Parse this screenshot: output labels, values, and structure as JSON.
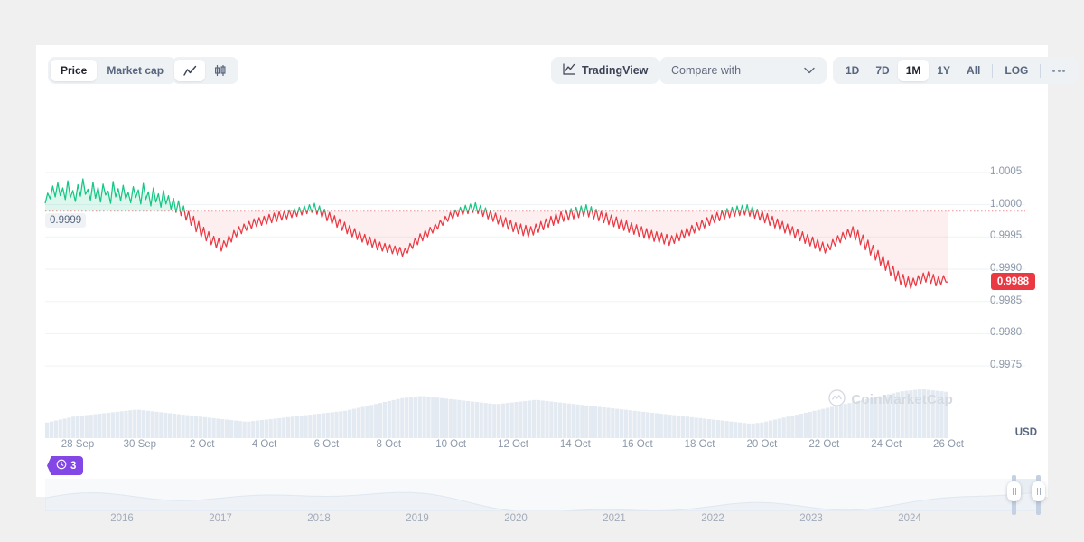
{
  "toolbar": {
    "metric_tabs": [
      {
        "label": "Price",
        "active": true
      },
      {
        "label": "Market cap",
        "active": false
      }
    ],
    "chart_type_icons": [
      {
        "name": "line-chart-icon",
        "active": true
      },
      {
        "name": "candlestick-chart-icon",
        "active": false
      }
    ],
    "tradingview_label": "TradingView",
    "tradingview_icon": "line-chart-icon",
    "compare_placeholder": "Compare with",
    "compare_chevron": "chevron-down-icon",
    "ranges": [
      {
        "label": "1D",
        "active": false
      },
      {
        "label": "7D",
        "active": false
      },
      {
        "label": "1M",
        "active": true
      },
      {
        "label": "1Y",
        "active": false
      },
      {
        "label": "All",
        "active": false
      }
    ],
    "log_label": "LOG",
    "more_icon": "ellipsis-icon"
  },
  "chart_overlay": {
    "currency_label": "USD",
    "current_price_badge": "0.9988",
    "baseline_label": "0.9999",
    "watermark": "CoinMarketCap",
    "watermark_icon": "coinmarketcap-logo-icon",
    "events_badge_count": "3",
    "events_badge_icon": "clock-icon"
  },
  "colors": {
    "up": "#16c784",
    "down": "#ea3943",
    "badge": "#ea3943",
    "events": "#8247e5",
    "volume": "#e4eaf1",
    "axis_text": "#8c98a9"
  },
  "chart_data": {
    "type": "line",
    "title": "",
    "xlabel": "",
    "ylabel": "USD",
    "ylim": [
      0.99725,
      1.00075
    ],
    "yticks": [
      "1.0005",
      "1.0000",
      "0.9995",
      "0.9990",
      "0.9985",
      "0.9980",
      "0.9975"
    ],
    "ytick_values": [
      1.0005,
      1.0,
      0.9995,
      0.999,
      0.9985,
      0.998,
      0.9975
    ],
    "xticks": [
      "28 Sep",
      "30 Sep",
      "2 Oct",
      "4 Oct",
      "6 Oct",
      "8 Oct",
      "10 Oct",
      "12 Oct",
      "14 Oct",
      "16 Oct",
      "18 Oct",
      "20 Oct",
      "22 Oct",
      "24 Oct",
      "26 Oct"
    ],
    "baseline": 0.9999,
    "last_value": 0.9988,
    "grid": true,
    "legend": "none",
    "series": [
      {
        "name": "Price (USD)",
        "color_up": "#16c784",
        "color_down": "#ea3943",
        "values": [
          1.00002,
          1.00018,
          1.00009,
          1.00029,
          1.00012,
          1.00034,
          1.00014,
          1.00026,
          1.00008,
          1.00037,
          1.00011,
          1.00022,
          1.00005,
          1.00031,
          1.00013,
          1.0004,
          1.00016,
          1.00024,
          1.00007,
          1.00035,
          1.0001,
          1.00027,
          1.00004,
          1.00032,
          1.00015,
          1.00021,
          1.00002,
          1.00036,
          1.00012,
          1.00025,
          1.00006,
          1.0003,
          1.00009,
          1.00019,
          1.00003,
          1.00028,
          1.00011,
          1.00023,
          1.00001,
          1.00033,
          1.00008,
          1.0002,
          0.99998,
          1.00026,
          1.00004,
          1.00017,
          0.99996,
          1.00022,
          1.00001,
          1.00014,
          0.99993,
          1.0001,
          0.99988,
          1.00006,
          0.99983,
          0.99998,
          0.99976,
          0.9999,
          0.99968,
          0.99982,
          0.99958,
          0.99974,
          0.9995,
          0.99965,
          0.99944,
          0.99958,
          0.99938,
          0.99951,
          0.99933,
          0.99948,
          0.99928,
          0.99944,
          0.99935,
          0.99952,
          0.99942,
          0.9996,
          0.9995,
          0.99966,
          0.99955,
          0.9997,
          0.9996,
          0.99974,
          0.99963,
          0.99978,
          0.99966,
          0.9998,
          0.99968,
          0.99982,
          0.9997,
          0.99985,
          0.99972,
          0.99987,
          0.99974,
          0.99989,
          0.99976,
          0.9999,
          0.99978,
          0.99992,
          0.9998,
          0.99994,
          0.99982,
          0.99996,
          0.99984,
          0.99998,
          0.99986,
          1.0,
          0.99988,
          1.00002,
          0.99985,
          0.99998,
          0.9998,
          0.99993,
          0.99975,
          0.99988,
          0.9997,
          0.99983,
          0.99965,
          0.99978,
          0.9996,
          0.99973,
          0.99955,
          0.99968,
          0.9995,
          0.99963,
          0.99946,
          0.99958,
          0.99942,
          0.99954,
          0.99938,
          0.9995,
          0.99934,
          0.99946,
          0.9993,
          0.99942,
          0.99928,
          0.9994,
          0.99926,
          0.99938,
          0.99924,
          0.99936,
          0.99922,
          0.99934,
          0.9992,
          0.99932,
          0.99925,
          0.9994,
          0.99932,
          0.99948,
          0.99938,
          0.99955,
          0.99944,
          0.9996,
          0.9995,
          0.99965,
          0.99956,
          0.9997,
          0.99962,
          0.99976,
          0.99968,
          0.99982,
          0.99974,
          0.99988,
          0.99978,
          0.99992,
          0.99982,
          0.99996,
          0.99984,
          0.99999,
          0.99986,
          1.00001,
          0.99988,
          1.00003,
          0.99986,
          0.99999,
          0.99982,
          0.99995,
          0.99978,
          0.99991,
          0.99974,
          0.99987,
          0.9997,
          0.99983,
          0.99966,
          0.9998,
          0.99962,
          0.99976,
          0.99958,
          0.99972,
          0.99955,
          0.9997,
          0.99952,
          0.99968,
          0.9995,
          0.99966,
          0.99953,
          0.9997,
          0.99957,
          0.99974,
          0.99961,
          0.99978,
          0.99965,
          0.99982,
          0.99968,
          0.99986,
          0.99971,
          0.99989,
          0.99974,
          0.99992,
          0.99976,
          0.99994,
          0.99978,
          0.99996,
          0.9998,
          0.99998,
          0.99982,
          1.0,
          0.99981,
          0.99997,
          0.99978,
          0.99993,
          0.99975,
          0.9999,
          0.99972,
          0.99987,
          0.99969,
          0.99984,
          0.99966,
          0.99981,
          0.99963,
          0.99978,
          0.9996,
          0.99975,
          0.99957,
          0.99972,
          0.99954,
          0.99969,
          0.99951,
          0.99966,
          0.99948,
          0.99963,
          0.99945,
          0.9996,
          0.99943,
          0.99958,
          0.99941,
          0.99956,
          0.99939,
          0.99954,
          0.99937,
          0.99952,
          0.9994,
          0.99956,
          0.99944,
          0.9996,
          0.99948,
          0.99964,
          0.99952,
          0.99968,
          0.99956,
          0.99972,
          0.9996,
          0.99976,
          0.99964,
          0.9998,
          0.99968,
          0.99984,
          0.99972,
          0.99988,
          0.99975,
          0.99991,
          0.99978,
          0.99994,
          0.9998,
          0.99996,
          0.99982,
          0.99998,
          0.99983,
          0.99999,
          0.99984,
          1.0,
          0.99982,
          0.99997,
          0.99979,
          0.99993,
          0.99976,
          0.9999,
          0.99972,
          0.99986,
          0.99968,
          0.99982,
          0.99964,
          0.99978,
          0.9996,
          0.99974,
          0.99956,
          0.9997,
          0.99952,
          0.99966,
          0.99948,
          0.99962,
          0.99944,
          0.99958,
          0.9994,
          0.99954,
          0.99936,
          0.9995,
          0.99932,
          0.99946,
          0.99928,
          0.99942,
          0.99925,
          0.99939,
          0.9993,
          0.99946,
          0.99936,
          0.99952,
          0.99941,
          0.99957,
          0.99946,
          0.99962,
          0.9995,
          0.99966,
          0.99945,
          0.9996,
          0.99938,
          0.99953,
          0.9993,
          0.99945,
          0.99922,
          0.99937,
          0.99914,
          0.99929,
          0.99906,
          0.99921,
          0.99898,
          0.99913,
          0.9989,
          0.99905,
          0.99882,
          0.99897,
          0.99876,
          0.99892,
          0.99872,
          0.99888,
          0.9987,
          0.99886,
          0.99874,
          0.9989,
          0.99878,
          0.99894,
          0.9988,
          0.99896,
          0.99878,
          0.99892,
          0.99874,
          0.99888,
          0.99876,
          0.9989,
          0.9988,
          0.9988
        ]
      }
    ],
    "volume_series": {
      "name": "Volume",
      "color": "#e4eaf1",
      "values": [
        32,
        34,
        36,
        38,
        40,
        42,
        44,
        45,
        46,
        47,
        48,
        49,
        50,
        51,
        52,
        53,
        54,
        55,
        56,
        57,
        58,
        58,
        57,
        56,
        55,
        54,
        53,
        52,
        51,
        50,
        49,
        48,
        47,
        46,
        45,
        44,
        43,
        42,
        41,
        40,
        39,
        38,
        37,
        36,
        35,
        34,
        34,
        35,
        36,
        37,
        38,
        39,
        40,
        41,
        42,
        43,
        44,
        45,
        46,
        47,
        48,
        49,
        50,
        51,
        52,
        53,
        54,
        55,
        56,
        58,
        60,
        62,
        64,
        66,
        68,
        70,
        72,
        74,
        76,
        78,
        80,
        82,
        83,
        84,
        85,
        86,
        86,
        85,
        84,
        83,
        82,
        81,
        80,
        79,
        78,
        77,
        76,
        75,
        74,
        73,
        72,
        71,
        70,
        70,
        71,
        72,
        73,
        74,
        75,
        76,
        77,
        78,
        78,
        77,
        76,
        75,
        74,
        73,
        72,
        71,
        70,
        69,
        68,
        67,
        66,
        65,
        64,
        63,
        62,
        61,
        60,
        59,
        58,
        57,
        56,
        55,
        54,
        53,
        52,
        51,
        50,
        49,
        48,
        47,
        46,
        45,
        44,
        43,
        42,
        41,
        40,
        39,
        38,
        37,
        36,
        35,
        34,
        33,
        32,
        31,
        30,
        30,
        31,
        32,
        34,
        36,
        38,
        40,
        42,
        44,
        46,
        48,
        50,
        52,
        54,
        56,
        58,
        60,
        62,
        64,
        66,
        68,
        70,
        72,
        74,
        76,
        78,
        80,
        82,
        84,
        86,
        88,
        90,
        92,
        94,
        96,
        97,
        98,
        99,
        100,
        100,
        99,
        98,
        97,
        96,
        95
      ]
    }
  },
  "navigator": {
    "year_ticks": [
      "2016",
      "2017",
      "2018",
      "2019",
      "2020",
      "2021",
      "2022",
      "2023",
      "2024"
    ],
    "handle_icon": "drag-handle-icon"
  }
}
